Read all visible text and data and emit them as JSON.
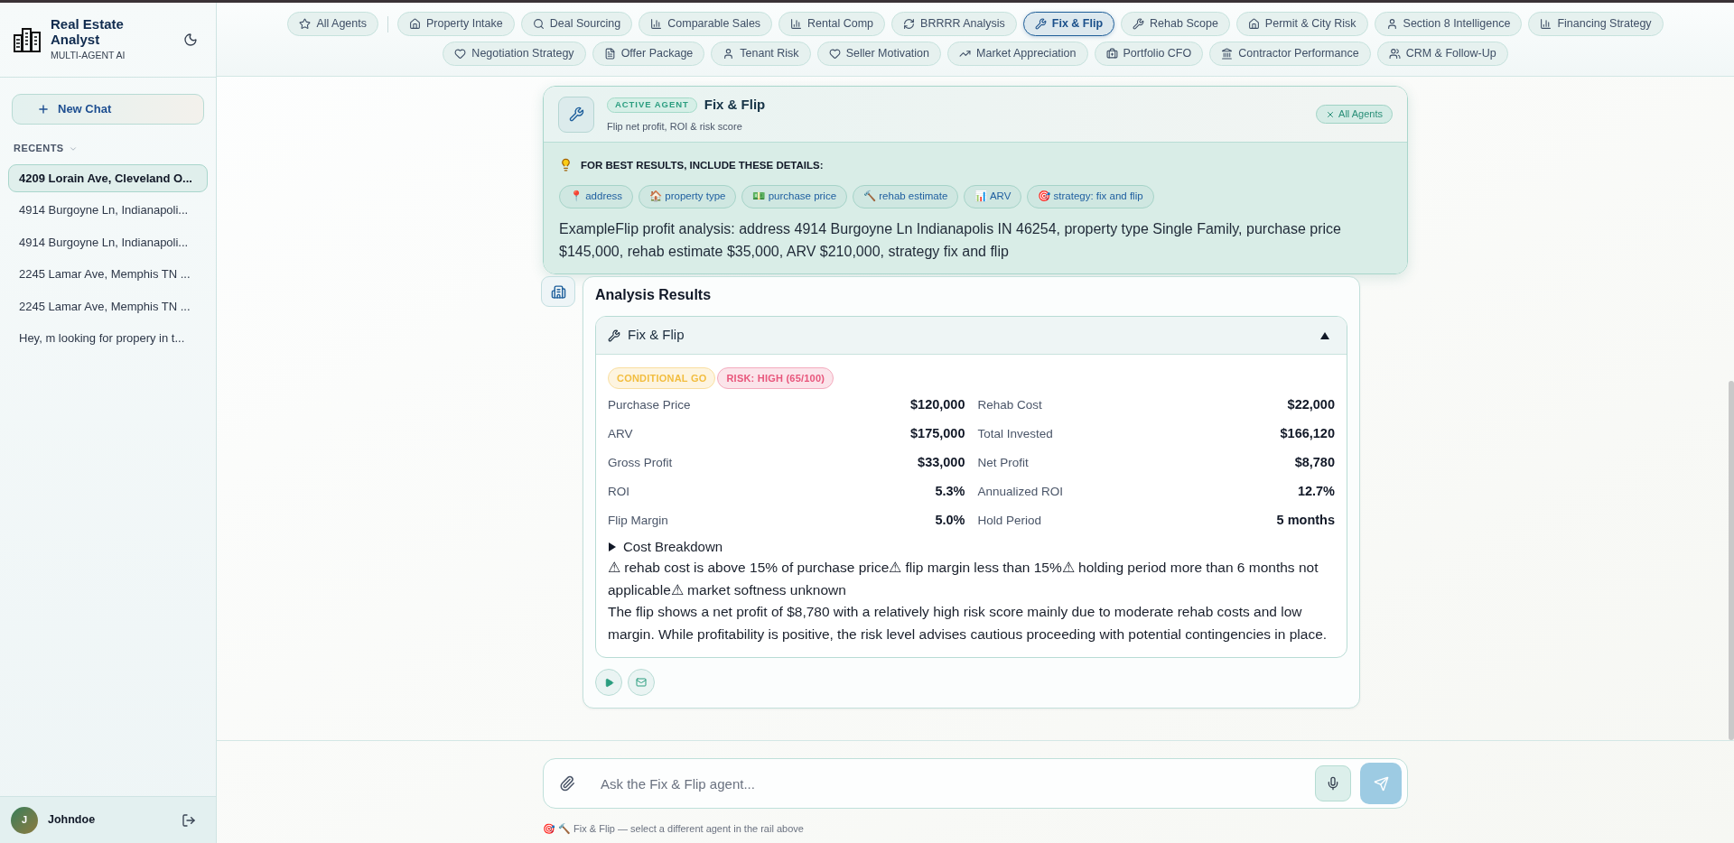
{
  "sidebar": {
    "brand": {
      "title": "Real Estate Analyst",
      "subtitle": "MULTI-AGENT AI"
    },
    "new_chat": "New Chat",
    "recents_label": "RECENTS",
    "recents": [
      {
        "label": "4209 Lorain Ave, Cleveland O...",
        "selected": true
      },
      {
        "label": "4914 Burgoyne Ln, Indianapoli...",
        "selected": false
      },
      {
        "label": "4914 Burgoyne Ln, Indianapoli...",
        "selected": false
      },
      {
        "label": "2245 Lamar Ave, Memphis TN ...",
        "selected": false
      },
      {
        "label": "2245 Lamar Ave, Memphis TN ...",
        "selected": false
      },
      {
        "label": "Hey, m looking for propery in t...",
        "selected": false
      }
    ],
    "user": {
      "initial": "J",
      "name": "Johndoe"
    }
  },
  "agent_rail": {
    "all_agents": {
      "label": "All Agents",
      "selected": false
    },
    "agents": [
      {
        "label": "Property Intake",
        "selected": false
      },
      {
        "label": "Deal Sourcing",
        "selected": false
      },
      {
        "label": "Comparable Sales",
        "selected": false
      },
      {
        "label": "Rental Comp",
        "selected": false
      },
      {
        "label": "BRRRR Analysis",
        "selected": false
      },
      {
        "label": "Fix & Flip",
        "selected": true
      },
      {
        "label": "Rehab Scope",
        "selected": false
      },
      {
        "label": "Permit & City Risk",
        "selected": false
      },
      {
        "label": "Section 8 Intelligence",
        "selected": false
      },
      {
        "label": "Financing Strategy",
        "selected": false
      },
      {
        "label": "Negotiation Strategy",
        "selected": false
      },
      {
        "label": "Offer Package",
        "selected": false
      },
      {
        "label": "Tenant Risk",
        "selected": false
      },
      {
        "label": "Seller Motivation",
        "selected": false
      },
      {
        "label": "Market Appreciation",
        "selected": false
      },
      {
        "label": "Portfolio CFO",
        "selected": false
      },
      {
        "label": "Contractor Performance",
        "selected": false
      },
      {
        "label": "CRM & Follow-Up",
        "selected": false
      }
    ]
  },
  "active_agent": {
    "badge": "ACTIVE AGENT",
    "name": "Fix & Flip",
    "description": "Flip net profit, ROI & risk score",
    "clear_button": "All Agents",
    "tips_title": "FOR BEST RESULTS, INCLUDE THESE DETAILS:",
    "detail_chips": [
      "📍 address",
      "🏠 property type",
      "💵 purchase price",
      "🔨 rehab estimate",
      "📊 ARV",
      "🎯 strategy: fix and flip"
    ],
    "example": "ExampleFlip profit analysis: address 4914 Burgoyne Ln Indianapolis IN 46254, property type Single Family, purchase price $145,000, rehab estimate $35,000, ARV $210,000, strategy fix and flip"
  },
  "message": {
    "title": "Analysis Results",
    "panel": {
      "title": "Fix & Flip",
      "expanded": true,
      "badges": [
        {
          "label": "CONDITIONAL GO",
          "color": "#f2bd3f"
        },
        {
          "label": "RISK: HIGH (65/100)",
          "color": "#e8567c"
        }
      ],
      "metrics": [
        {
          "label": "Purchase Price",
          "value": "$120,000"
        },
        {
          "label": "Rehab Cost",
          "value": "$22,000"
        },
        {
          "label": "ARV",
          "value": "$175,000"
        },
        {
          "label": "Total Invested",
          "value": "$166,120"
        },
        {
          "label": "Gross Profit",
          "value": "$33,000"
        },
        {
          "label": "Net Profit",
          "value": "$8,780"
        },
        {
          "label": "ROI",
          "value": "5.3%"
        },
        {
          "label": "Annualized ROI",
          "value": "12.7%"
        },
        {
          "label": "Flip Margin",
          "value": "5.0%"
        },
        {
          "label": "Hold Period",
          "value": "5 months"
        }
      ],
      "cost_breakdown": {
        "label": "Cost Breakdown",
        "expanded": false
      },
      "warnings": "⚠ rehab cost is above 15% of purchase price⚠ flip margin less than 15%⚠ holding period more than 6 months not applicable⚠ market softness unknown",
      "summary": "The flip shows a net profit of $8,780 with a relatively high risk score mainly due to moderate rehab costs and low margin. While profitability is positive, the risk level advises cautious proceeding with potential contingencies in place."
    }
  },
  "composer": {
    "placeholder": "Ask the Fix & Flip agent...",
    "note": "🎯 🔨 Fix & Flip — select a different agent in the rail above"
  }
}
